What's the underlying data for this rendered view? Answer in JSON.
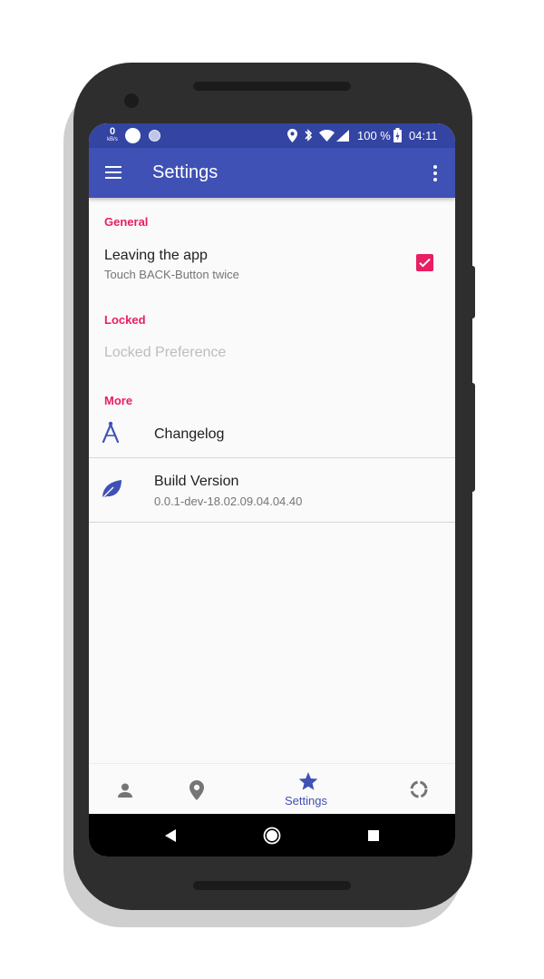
{
  "status_bar": {
    "net_speed_value": "0",
    "net_speed_unit": "kB/s",
    "battery_percent": "100 %",
    "time": "04:11"
  },
  "app_bar": {
    "title": "Settings"
  },
  "settings": {
    "general": {
      "header": "General",
      "leaving_app_title": "Leaving the app",
      "leaving_app_summary": "Touch BACK-Button twice",
      "leaving_app_checked": true
    },
    "locked": {
      "header": "Locked",
      "locked_pref_title": "Locked Preference"
    },
    "more": {
      "header": "More",
      "changelog_title": "Changelog",
      "build_version_title": "Build Version",
      "build_version_value": "0.0.1-dev-18.02.09.04.04.40"
    }
  },
  "bottom_nav": {
    "items": [
      {
        "icon": "person-icon",
        "label": ""
      },
      {
        "icon": "location-pin-icon",
        "label": ""
      },
      {
        "icon": "star-icon",
        "label": "Settings",
        "active": true
      },
      {
        "icon": "loading-circle-icon",
        "label": ""
      }
    ]
  },
  "colors": {
    "primary": "#3f51b5",
    "primary_dark": "#3344a3",
    "accent": "#e91e63"
  }
}
